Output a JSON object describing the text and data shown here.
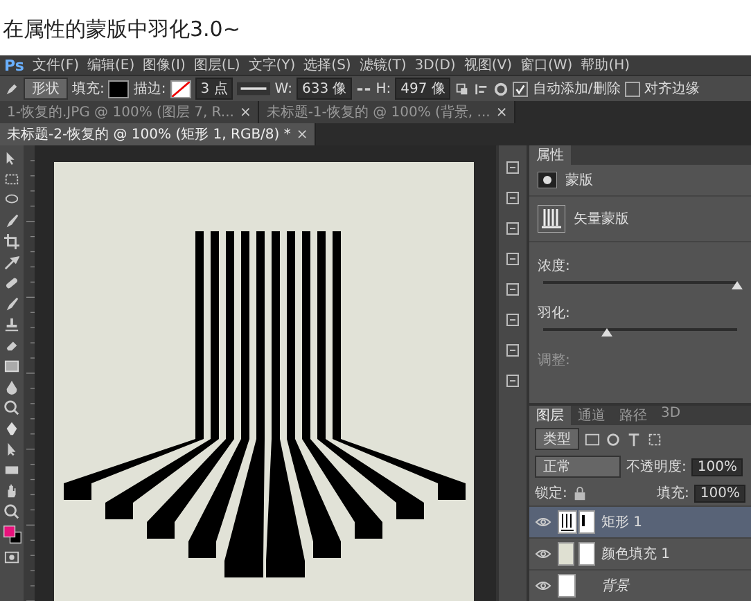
{
  "heading": "在属性的蒙版中羽化3.0~",
  "app": {
    "logo": "Ps",
    "menu": [
      "文件(F)",
      "编辑(E)",
      "图像(I)",
      "图层(L)",
      "文字(Y)",
      "选择(S)",
      "滤镜(T)",
      "3D(D)",
      "视图(V)",
      "窗口(W)",
      "帮助(H)"
    ]
  },
  "options_bar": {
    "shape_mode": "形状",
    "fill_label": "填充:",
    "stroke_label": "描边:",
    "stroke_width": "3 点",
    "w_label": "W:",
    "w_value": "633 像",
    "h_label": "H:",
    "h_value": "497 像",
    "checkboxes": [
      {
        "label": "自动添加/删除",
        "checked": true
      },
      {
        "label": "对齐边缘",
        "checked": false
      }
    ]
  },
  "tabs": [
    {
      "label": "1-恢复的.JPG @ 100% (图层 7, R...",
      "close": "×",
      "selected": false
    },
    {
      "label": "未标题-1-恢复的 @ 100% (背景, ...",
      "close": "×",
      "selected": false
    },
    {
      "label": "未标题-2-恢复的 @ 100% (矩形 1, RGB/8) *",
      "close": "×",
      "selected": true
    }
  ],
  "properties": {
    "title": "属性",
    "mask_type": "蒙版",
    "mask_name": "矢量蒙版",
    "sliders": [
      {
        "label": "浓度:",
        "level": 1
      },
      {
        "label": "羽化:",
        "level": 0.33
      }
    ],
    "adjust_label": "调整:"
  },
  "layers": {
    "tabs": [
      {
        "label": "图层",
        "selected": true
      },
      {
        "label": "通道",
        "selected": false
      },
      {
        "label": "路径",
        "selected": false
      },
      {
        "label": "3D",
        "selected": false
      }
    ],
    "filter": "类型",
    "blend_mode": "正常",
    "opacity_label": "不透明度:",
    "opacity": "100%",
    "lock_label": "锁定:",
    "fill_label": "填充:",
    "fill": "100%",
    "items": [
      {
        "name": "矩形 1",
        "kind": "shape",
        "selected": true,
        "visible": true
      },
      {
        "name": "颜色填充 1",
        "kind": "fill",
        "selected": false,
        "visible": true
      },
      {
        "name": "背景",
        "kind": "background",
        "selected": false,
        "visible": true
      }
    ]
  }
}
